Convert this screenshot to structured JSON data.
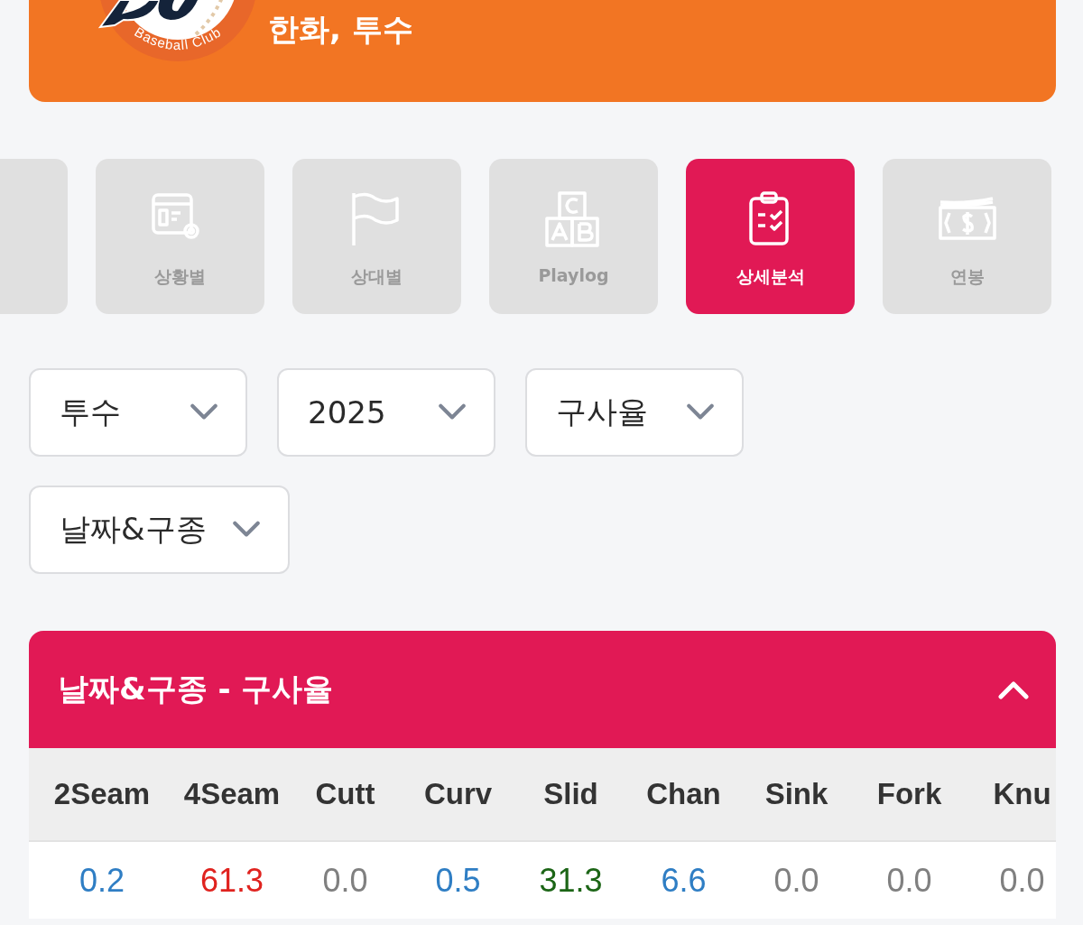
{
  "header": {
    "logo_caption": "Baseball Club",
    "title": "한화, 투수"
  },
  "tabs": [
    {
      "kind": "cut",
      "selected": false
    },
    {
      "kind": "situation",
      "label": "상황별",
      "selected": false
    },
    {
      "kind": "opponent",
      "label": "상대별",
      "selected": false
    },
    {
      "kind": "playlog",
      "label": "Playlog",
      "selected": false
    },
    {
      "kind": "detail",
      "label": "상세분석",
      "selected": true
    },
    {
      "kind": "salary",
      "label": "연봉",
      "selected": false
    }
  ],
  "filters": [
    {
      "value": "투수"
    },
    {
      "value": "2025"
    },
    {
      "value": "구사율"
    },
    {
      "value": "날짜&구종"
    }
  ],
  "section": {
    "title": "날짜&구종 - 구사율",
    "expanded": true,
    "table": {
      "columns": [
        "2Seam",
        "4Seam",
        "Cutt",
        "Curv",
        "Slid",
        "Chan",
        "Sink",
        "Fork",
        "Knu"
      ],
      "rows": [
        [
          {
            "value": "0.2",
            "color": "#2f7ec4"
          },
          {
            "value": "61.3",
            "color": "#e0231f"
          },
          {
            "value": "0.0",
            "color": "#808080"
          },
          {
            "value": "0.5",
            "color": "#2f7ec4"
          },
          {
            "value": "31.3",
            "color": "#1c6516"
          },
          {
            "value": "6.6",
            "color": "#2f7ec4"
          },
          {
            "value": "0.0",
            "color": "#808080"
          },
          {
            "value": "0.0",
            "color": "#808080"
          },
          {
            "value": "0.0",
            "color": "#808080"
          }
        ]
      ]
    }
  }
}
